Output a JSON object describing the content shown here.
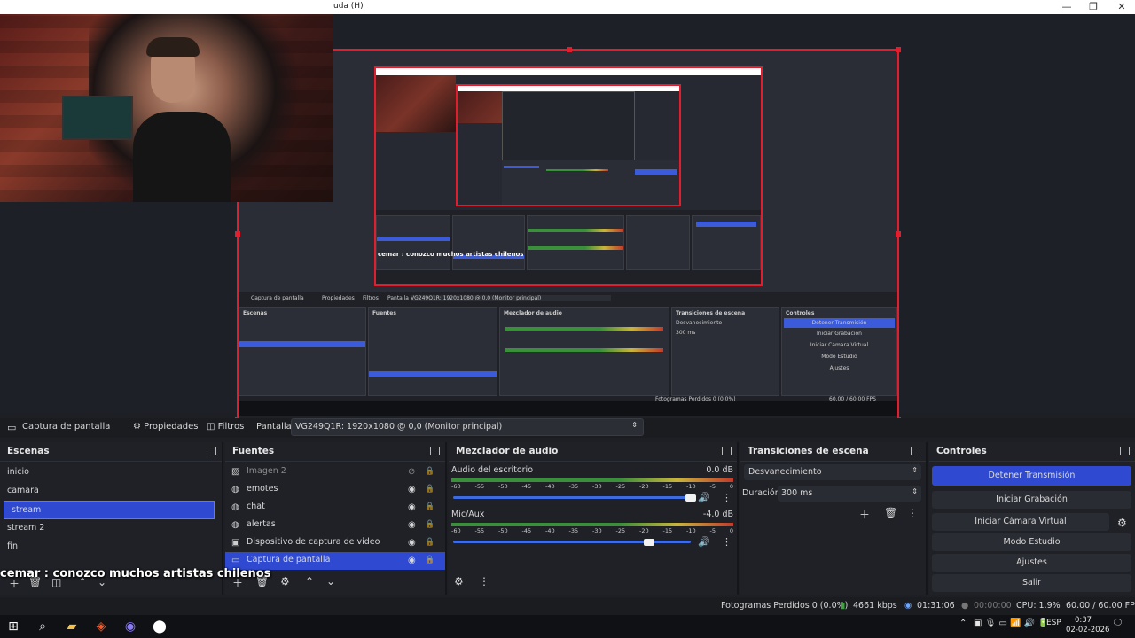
{
  "window": {
    "title": "uda (H)",
    "controls": [
      "—",
      "❐",
      "✕"
    ]
  },
  "preview": {
    "nested_texts": [
      "Captura de pantalla",
      "Propiedades",
      "Filtros",
      "Pantalla",
      "VG249Q1R: 1920x1080 @ 0,0 (Monitor principal)",
      "Escenas",
      "Fuentes",
      "Mezclador de audio",
      "Transiciones de escena",
      "Controles",
      "Detener Transmisión",
      "Iniciar Grabación",
      "Iniciar Cámara Virtual",
      "Modo Estudio",
      "Ajustes",
      "Salir",
      "Desvanecimiento",
      "Duración",
      "300 ms",
      "Fotogramas Perdidos 0 (0.0%)",
      "4661 kbps",
      "01:31:06",
      "CPU: 1.9%",
      "60.00 / 60.00 FPS"
    ],
    "nested_overlay": "cemar : conozco muchos artistas chilenos"
  },
  "source_toolbar": {
    "source_name": "Captura de pantalla",
    "properties_label": "Propiedades",
    "filters_label": "Filtros",
    "display_label": "Pantalla",
    "display_value": "VG249Q1R: 1920x1080 @ 0,0 (Monitor principal)"
  },
  "scenes": {
    "title": "Escenas",
    "items": [
      "inicio",
      "camara",
      "stream",
      "stream 2",
      "fin"
    ],
    "selected": "stream"
  },
  "sources": {
    "title": "Fuentes",
    "items": [
      {
        "name": "Imagen 2",
        "icon": "image-icon",
        "visible": false
      },
      {
        "name": "emotes",
        "icon": "browser-icon",
        "visible": true
      },
      {
        "name": "chat",
        "icon": "browser-icon",
        "visible": true
      },
      {
        "name": "alertas",
        "icon": "browser-icon",
        "visible": true
      },
      {
        "name": "Dispositivo de captura de video",
        "icon": "camera-icon",
        "visible": true
      },
      {
        "name": "Captura de pantalla",
        "icon": "monitor-icon",
        "visible": true
      }
    ]
  },
  "mixer": {
    "title": "Mezclador de audio",
    "ticks": [
      "-60",
      "-55",
      "-50",
      "-45",
      "-40",
      "-35",
      "-30",
      "-25",
      "-20",
      "-15",
      "-10",
      "-5",
      "0"
    ],
    "channels": [
      {
        "name": "Audio del escritorio",
        "db": "0.0 dB",
        "volume": 1.0
      },
      {
        "name": "Mic/Aux",
        "db": "-4.0 dB",
        "volume": 0.82
      }
    ]
  },
  "transitions": {
    "title": "Transiciones de escena",
    "selected": "Desvanecimiento",
    "duration_label": "Duración",
    "duration_value": "300 ms"
  },
  "controls": {
    "title": "Controles",
    "buttons": [
      "Detener Transmisión",
      "Iniciar Grabación",
      "Iniciar Cámara Virtual",
      "Modo Estudio",
      "Ajustes",
      "Salir"
    ]
  },
  "overlay_chat": "cemar : conozco muchos artistas chilenos",
  "status": {
    "dropped": "Fotogramas Perdidos 0 (0.0%)",
    "bitrate": "4661 kbps",
    "stream_time": "01:31:06",
    "rec_time": "00:00:00",
    "cpu": "CPU: 1.9%",
    "fps": "60.00 / 60.00 FPS"
  },
  "taskbar": {
    "lang": "ESP",
    "time": "0:37",
    "date": "02-02-2026"
  },
  "colors": {
    "accent": "#2f4ad0",
    "recording_border": "#e01e2e"
  }
}
